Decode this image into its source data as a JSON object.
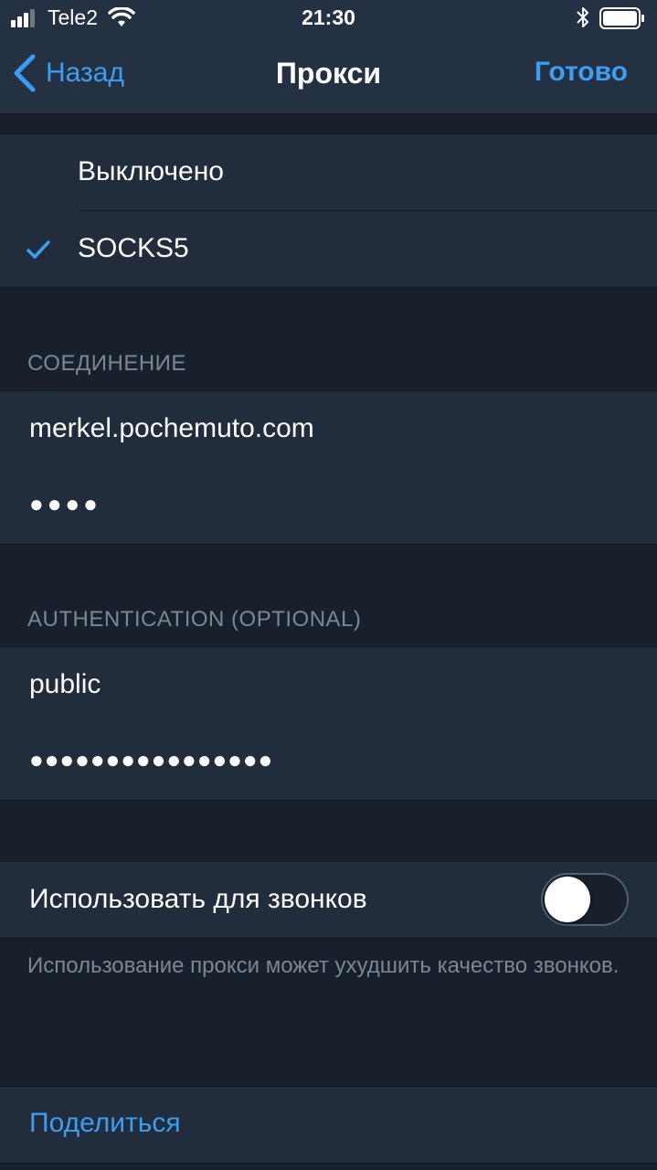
{
  "status_bar": {
    "carrier": "Tele2",
    "time": "21:30",
    "icons": [
      "signal-icon",
      "wifi-icon",
      "bluetooth-icon",
      "battery-icon"
    ]
  },
  "nav": {
    "back_label": "Назад",
    "title": "Прокси",
    "done_label": "Готово"
  },
  "proxy_type": {
    "options": [
      {
        "label": "Выключено",
        "selected": false
      },
      {
        "label": "SOCKS5",
        "selected": true
      }
    ]
  },
  "connection": {
    "header": "СОЕДИНЕНИЕ",
    "server": "merkel.pochemuto.com",
    "port_masked": "●●●●"
  },
  "auth": {
    "header": "AUTHENTICATION (OPTIONAL)",
    "username": "public",
    "password_masked": "●●●●●●●●●●●●●●●●"
  },
  "calls": {
    "label": "Использовать для звонков",
    "enabled": false,
    "footnote": "Использование прокси может ухудшить качество звонков."
  },
  "share_label": "Поделиться",
  "colors": {
    "accent": "#3d9df0",
    "background": "#18202c",
    "cell": "#212d3c",
    "header_text": "#7b8796"
  }
}
